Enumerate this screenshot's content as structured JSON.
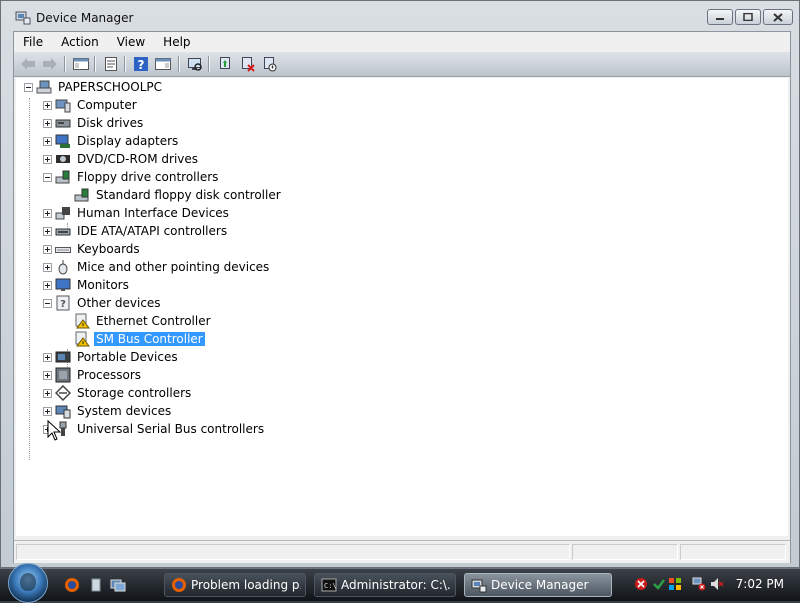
{
  "window": {
    "title": "Device Manager"
  },
  "menu": [
    "File",
    "Action",
    "View",
    "Help"
  ],
  "tree": {
    "root": "PAPERSCHOOLPC",
    "items": [
      {
        "label": "Computer",
        "icon": "computer-icon",
        "expanded": false
      },
      {
        "label": "Disk drives",
        "icon": "disk-drive-icon",
        "expanded": false
      },
      {
        "label": "Display adapters",
        "icon": "display-adapter-icon",
        "expanded": false
      },
      {
        "label": "DVD/CD-ROM drives",
        "icon": "dvd-drive-icon",
        "expanded": false
      },
      {
        "label": "Floppy drive controllers",
        "icon": "floppy-controller-icon",
        "expanded": true,
        "children": [
          {
            "label": "Standard floppy disk controller",
            "icon": "floppy-controller-icon"
          }
        ]
      },
      {
        "label": "Human Interface Devices",
        "icon": "hid-icon",
        "expanded": false
      },
      {
        "label": "IDE ATA/ATAPI controllers",
        "icon": "ide-controller-icon",
        "expanded": false
      },
      {
        "label": "Keyboards",
        "icon": "keyboard-icon",
        "expanded": false
      },
      {
        "label": "Mice and other pointing devices",
        "icon": "mouse-icon",
        "expanded": false
      },
      {
        "label": "Monitors",
        "icon": "monitor-icon",
        "expanded": false
      },
      {
        "label": "Other devices",
        "icon": "other-devices-icon",
        "expanded": true,
        "children": [
          {
            "label": "Ethernet Controller",
            "icon": "warning-device-icon"
          },
          {
            "label": "SM Bus Controller",
            "icon": "warning-device-icon",
            "selected": true
          }
        ]
      },
      {
        "label": "Portable Devices",
        "icon": "portable-device-icon",
        "expanded": false
      },
      {
        "label": "Processors",
        "icon": "processor-icon",
        "expanded": false
      },
      {
        "label": "Storage controllers",
        "icon": "storage-controller-icon",
        "expanded": false
      },
      {
        "label": "System devices",
        "icon": "system-devices-icon",
        "expanded": false
      },
      {
        "label": "Universal Serial Bus controllers",
        "icon": "usb-icon",
        "expanded": false
      }
    ]
  },
  "taskbar": {
    "tasks": [
      {
        "label": "Problem loading p...",
        "icon": "firefox-icon"
      },
      {
        "label": "Administrator: C:\\...",
        "icon": "cmd-icon"
      },
      {
        "label": "Device Manager",
        "icon": "device-manager-icon",
        "active": true
      }
    ],
    "clock": "7:02 PM"
  },
  "colors": {
    "selection": "#3399ff",
    "warning": "#f2c200"
  }
}
